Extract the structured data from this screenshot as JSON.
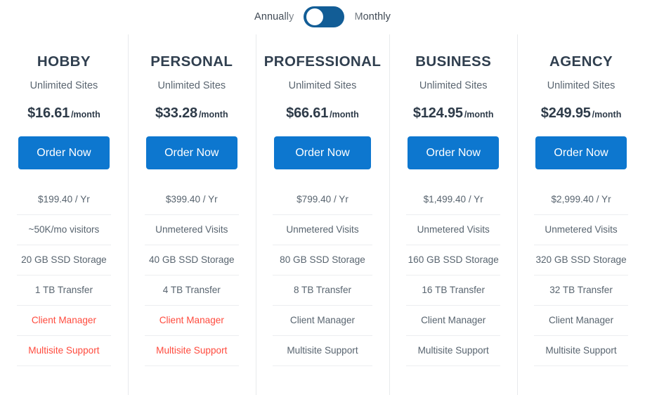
{
  "billing_toggle": {
    "left_label": "Annually",
    "right_label": "Monthly",
    "selected": "Annually",
    "track_color": "#125d96",
    "knob_color": "#ffffff"
  },
  "theme": {
    "button_blue": "#0d77cf",
    "highlight_red": "#ff4b3e",
    "heading_color": "#303f4f",
    "feature_color": "#58646f",
    "divider_color": "#e8eaec"
  },
  "feature_labels": [
    "yearly_price",
    "visits",
    "storage",
    "transfer",
    "client_manager",
    "multisite_support"
  ],
  "plans": [
    {
      "name": "HOBBY",
      "subtitle": "Unlimited Sites",
      "price_amount": "$16.61",
      "price_period": "/month",
      "cta_label": "Order Now",
      "features": [
        {
          "text": "$199.40 / Yr",
          "highlight": false
        },
        {
          "text": "~50K/mo visitors",
          "highlight": false
        },
        {
          "text": "20 GB SSD Storage",
          "highlight": false
        },
        {
          "text": "1 TB Transfer",
          "highlight": false
        },
        {
          "text": "Client Manager",
          "highlight": true
        },
        {
          "text": "Multisite Support",
          "highlight": true
        }
      ]
    },
    {
      "name": "PERSONAL",
      "subtitle": "Unlimited Sites",
      "price_amount": "$33.28",
      "price_period": "/month",
      "cta_label": "Order Now",
      "features": [
        {
          "text": "$399.40 / Yr",
          "highlight": false
        },
        {
          "text": "Unmetered Visits",
          "highlight": false
        },
        {
          "text": "40 GB SSD Storage",
          "highlight": false
        },
        {
          "text": "4 TB Transfer",
          "highlight": false
        },
        {
          "text": "Client Manager",
          "highlight": true
        },
        {
          "text": "Multisite Support",
          "highlight": true
        }
      ]
    },
    {
      "name": "PROFESSIONAL",
      "subtitle": "Unlimited Sites",
      "price_amount": "$66.61",
      "price_period": "/month",
      "cta_label": "Order Now",
      "features": [
        {
          "text": "$799.40 / Yr",
          "highlight": false
        },
        {
          "text": "Unmetered Visits",
          "highlight": false
        },
        {
          "text": "80 GB SSD Storage",
          "highlight": false
        },
        {
          "text": "8 TB Transfer",
          "highlight": false
        },
        {
          "text": "Client Manager",
          "highlight": false
        },
        {
          "text": "Multisite Support",
          "highlight": false
        }
      ]
    },
    {
      "name": "BUSINESS",
      "subtitle": "Unlimited Sites",
      "price_amount": "$124.95",
      "price_period": "/month",
      "cta_label": "Order Now",
      "features": [
        {
          "text": "$1,499.40 / Yr",
          "highlight": false
        },
        {
          "text": "Unmetered Visits",
          "highlight": false
        },
        {
          "text": "160 GB SSD Storage",
          "highlight": false
        },
        {
          "text": "16 TB Transfer",
          "highlight": false
        },
        {
          "text": "Client Manager",
          "highlight": false
        },
        {
          "text": "Multisite Support",
          "highlight": false
        }
      ]
    },
    {
      "name": "AGENCY",
      "subtitle": "Unlimited Sites",
      "price_amount": "$249.95",
      "price_period": "/month",
      "cta_label": "Order Now",
      "features": [
        {
          "text": "$2,999.40 / Yr",
          "highlight": false
        },
        {
          "text": "Unmetered Visits",
          "highlight": false
        },
        {
          "text": "320 GB SSD Storage",
          "highlight": false
        },
        {
          "text": "32 TB Transfer",
          "highlight": false
        },
        {
          "text": "Client Manager",
          "highlight": false
        },
        {
          "text": "Multisite Support",
          "highlight": false
        }
      ]
    }
  ]
}
